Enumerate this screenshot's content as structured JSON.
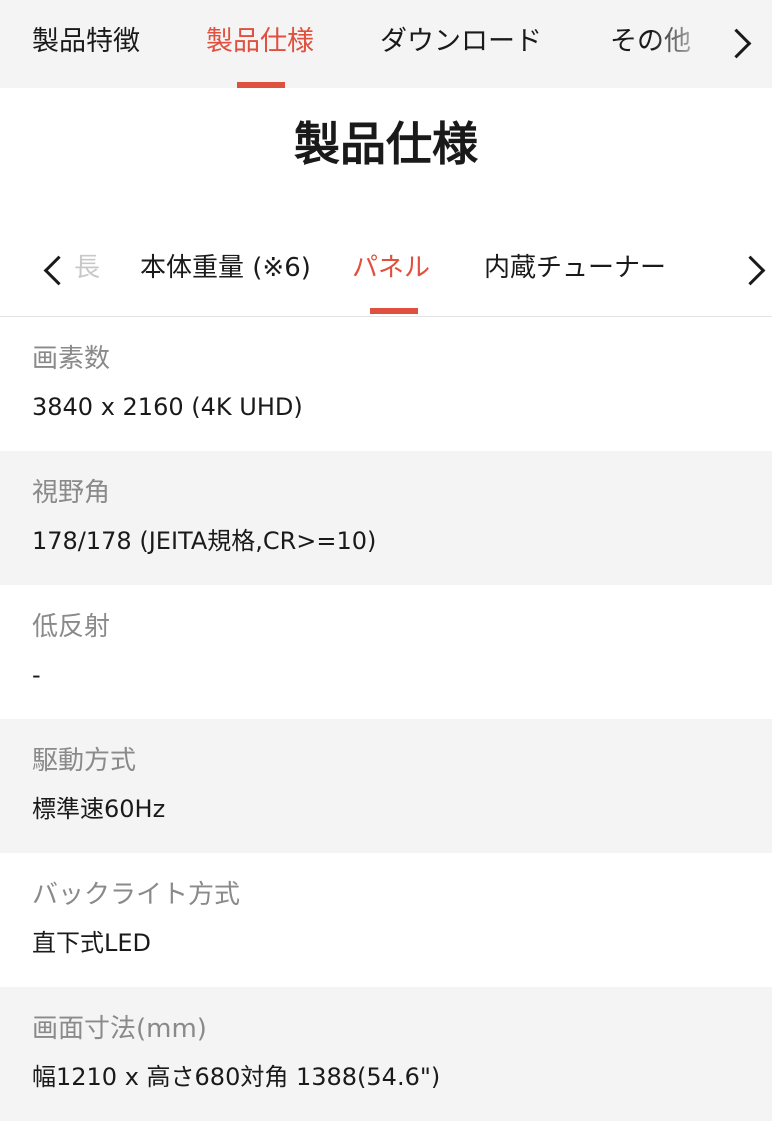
{
  "top_nav": {
    "tabs": [
      {
        "label": "製品特徴",
        "active": false
      },
      {
        "label": "製品仕様",
        "active": true
      },
      {
        "label": "ダウンロード",
        "active": false
      },
      {
        "label": "その他",
        "active": false
      }
    ],
    "next_icon": "chevron-right-icon",
    "accent_color": "#e0503e"
  },
  "page_title": "製品仕様",
  "sub_nav": {
    "tabs": [
      {
        "label": "長",
        "active": false,
        "partial": true
      },
      {
        "label": "本体重量 (※6)",
        "active": false
      },
      {
        "label": "パネル",
        "active": true
      },
      {
        "label": "内蔵チューナー",
        "active": false
      }
    ],
    "prev_icon": "chevron-left-icon",
    "next_icon": "chevron-right-icon"
  },
  "specs": [
    {
      "label": "画素数",
      "value": "3840 x 2160 (4K UHD)"
    },
    {
      "label": "視野角",
      "value": "178/178 (JEITA規格,CR>=10)"
    },
    {
      "label": "低反射",
      "value": "-"
    },
    {
      "label": "駆動方式",
      "value": "標準速60Hz"
    },
    {
      "label": "バックライト方式",
      "value": "直下式LED"
    },
    {
      "label": "画面寸法(mm)",
      "value": "幅1210 x 高さ680対角 1388(54.6\")"
    }
  ]
}
